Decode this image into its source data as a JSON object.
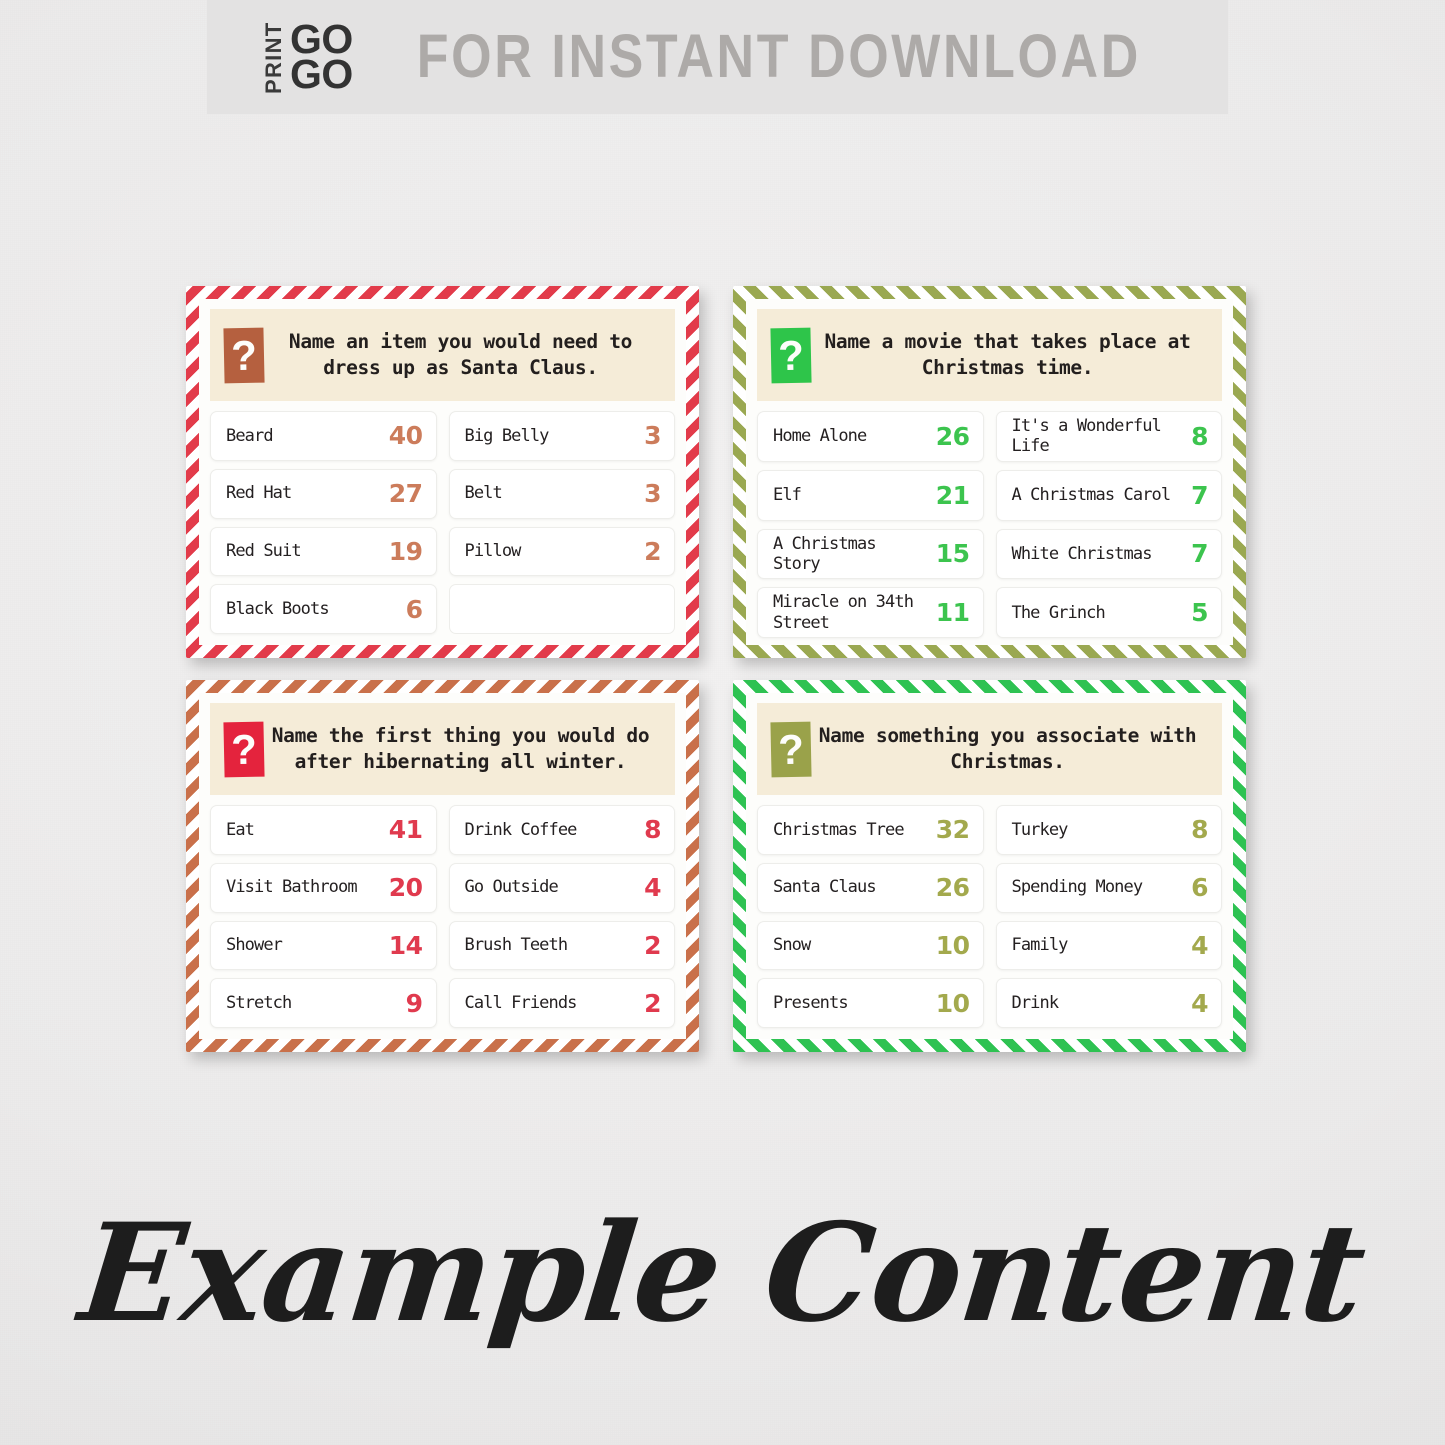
{
  "banner": {
    "logo_print": "PRINT",
    "logo_go_top": "GO",
    "logo_go_bottom": "GO",
    "title": "FOR INSTANT DOWNLOAD"
  },
  "footer": {
    "script_text": "Example Content"
  },
  "colors": {
    "banner_bg": "#e3e2e2",
    "banner_title": "#adaaa8",
    "card_inner_bg": "#fdfdfb",
    "question_bg": "#f5ecd8",
    "answer_bg": "#ffffff",
    "text_dark": "#231f1e"
  },
  "cards": [
    {
      "id": "card-santa-outfit",
      "question": "Name an item you would need to dress up as Santa Claus.",
      "question_icon": "question-mark-icon",
      "stripe_color": "#e23b4a",
      "stripe_direction": "left",
      "question_box_color": "#b5603f",
      "score_color": "#cc7c5b",
      "answers": [
        {
          "label": "Beard",
          "score": "40"
        },
        {
          "label": "Big Belly",
          "score": "3"
        },
        {
          "label": "Red Hat",
          "score": "27"
        },
        {
          "label": "Belt",
          "score": "3"
        },
        {
          "label": "Red Suit",
          "score": "19"
        },
        {
          "label": "Pillow",
          "score": "2"
        },
        {
          "label": "Black Boots",
          "score": "6"
        },
        {
          "label": "",
          "score": ""
        }
      ]
    },
    {
      "id": "card-christmas-movies",
      "question": "Name a movie that takes place at Christmas time.",
      "question_icon": "question-mark-icon",
      "stripe_color": "#9aa851",
      "stripe_direction": "right",
      "question_box_color": "#2ec54a",
      "score_color": "#3cc44e",
      "answers": [
        {
          "label": "Home Alone",
          "score": "26"
        },
        {
          "label": "It's a Wonderful Life",
          "score": "8"
        },
        {
          "label": "Elf",
          "score": "21"
        },
        {
          "label": "A Christmas Carol",
          "score": "7"
        },
        {
          "label": "A Christmas Story",
          "score": "15"
        },
        {
          "label": "White Christmas",
          "score": "7"
        },
        {
          "label": "Miracle on 34th Street",
          "score": "11"
        },
        {
          "label": "The Grinch",
          "score": "5"
        }
      ]
    },
    {
      "id": "card-after-hibernating",
      "question": "Name the first thing you would do after hibernating all winter.",
      "question_icon": "question-mark-icon",
      "stripe_color": "#c9704a",
      "stripe_direction": "left",
      "question_box_color": "#e4233d",
      "score_color": "#e03a4e",
      "answers": [
        {
          "label": "Eat",
          "score": "41"
        },
        {
          "label": "Drink Coffee",
          "score": "8"
        },
        {
          "label": "Visit Bathroom",
          "score": "20"
        },
        {
          "label": "Go Outside",
          "score": "4"
        },
        {
          "label": "Shower",
          "score": "14"
        },
        {
          "label": "Brush Teeth",
          "score": "2"
        },
        {
          "label": "Stretch",
          "score": "9"
        },
        {
          "label": "Call Friends",
          "score": "2"
        }
      ]
    },
    {
      "id": "card-associate-christmas",
      "question": "Name something you associate with Christmas.",
      "question_icon": "question-mark-icon",
      "stripe_color": "#2ec252",
      "stripe_direction": "right",
      "question_box_color": "#9aa24a",
      "score_color": "#a3a94d",
      "answers": [
        {
          "label": "Christmas Tree",
          "score": "32"
        },
        {
          "label": "Turkey",
          "score": "8"
        },
        {
          "label": "Santa Claus",
          "score": "26"
        },
        {
          "label": "Spending Money",
          "score": "6"
        },
        {
          "label": "Snow",
          "score": "10"
        },
        {
          "label": "Family",
          "score": "4"
        },
        {
          "label": "Presents",
          "score": "10"
        },
        {
          "label": "Drink",
          "score": "4"
        }
      ]
    }
  ]
}
